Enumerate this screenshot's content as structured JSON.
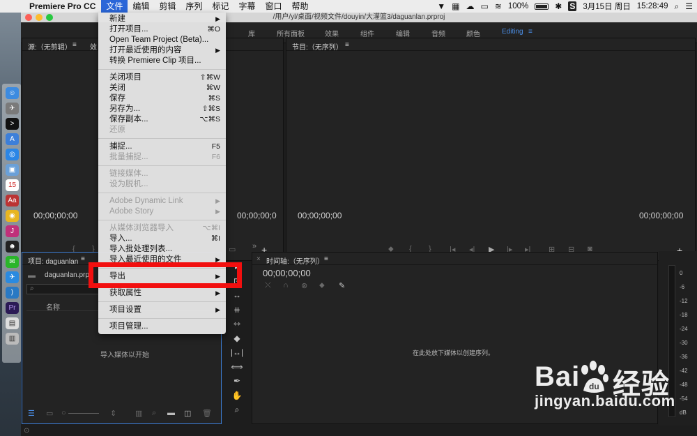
{
  "menubar": {
    "app": "Premiere Pro CC",
    "items": [
      "文件",
      "编辑",
      "剪辑",
      "序列",
      "标记",
      "字幕",
      "窗口",
      "帮助"
    ],
    "battery": "100%",
    "date": "3月15日 周日",
    "time": "15:28:49"
  },
  "window": {
    "title": "/用户/yl/桌面/视频文件/douyin/大灌篮3/daguanlan.prproj",
    "workspaces": [
      "库",
      "所有面板",
      "效果",
      "组件",
      "编辑",
      "音频",
      "颜色",
      "Editing"
    ]
  },
  "source_panel": {
    "title": "源:（无剪辑）",
    "tab2": "效",
    "tc_left": "00;00;00;00",
    "tc_right": "00;00;00;0"
  },
  "program_panel": {
    "title": "节目:（无序列）",
    "tc_left": "00;00;00;00",
    "tc_right": "00;00;00;00"
  },
  "project_panel": {
    "title": "项目: daguanlan",
    "file": "daguanlan.prpr",
    "column_name": "名称",
    "empty_hint": "导入媒体以开始"
  },
  "timeline_panel": {
    "title": "时间轴:（无序列）",
    "tc": "00;00;00;00",
    "empty_hint": "在此处放下媒体以创建序列。"
  },
  "meter": {
    "labels": [
      "0",
      "-6",
      "-12",
      "-18",
      "-24",
      "-30",
      "-36",
      "-42",
      "-48",
      "-54",
      "dB"
    ]
  },
  "file_menu": {
    "items": [
      {
        "label": "新建",
        "arrow": true
      },
      {
        "label": "打开项目...",
        "shortcut": "⌘O"
      },
      {
        "label": "Open Team Project (Beta)..."
      },
      {
        "label": "打开最近使用的内容",
        "arrow": true
      },
      {
        "label": "转换 Premiere Clip 项目..."
      },
      {
        "label": "关闭项目",
        "shortcut": "⇧⌘W"
      },
      {
        "label": "关闭",
        "shortcut": "⌘W"
      },
      {
        "label": "保存",
        "shortcut": "⌘S"
      },
      {
        "label": "另存为...",
        "shortcut": "⇧⌘S"
      },
      {
        "label": "保存副本...",
        "shortcut": "⌥⌘S"
      },
      {
        "label": "还原",
        "disabled": true
      },
      {
        "label": "捕捉...",
        "shortcut": "F5"
      },
      {
        "label": "批量捕捉...",
        "shortcut": "F6",
        "disabled": true
      },
      {
        "label": "链接媒体...",
        "disabled": true
      },
      {
        "label": "设为脱机...",
        "disabled": true
      },
      {
        "label": "Adobe Dynamic Link",
        "arrow": true,
        "disabled": true
      },
      {
        "label": "Adobe Story",
        "arrow": true,
        "disabled": true
      },
      {
        "label": "从媒体浏览器导入",
        "shortcut": "⌥⌘I",
        "disabled": true
      },
      {
        "label": "导入...",
        "shortcut": "⌘I"
      },
      {
        "label": "导入批处理列表..."
      },
      {
        "label": "导入最近使用的文件",
        "arrow": true
      },
      {
        "label": "导出",
        "arrow": true
      },
      {
        "label": "获取属性",
        "arrow": true
      },
      {
        "label": "项目设置",
        "arrow": true
      },
      {
        "label": "项目管理..."
      }
    ]
  },
  "watermark": {
    "brand": "Bai",
    "brand_cn": "经验",
    "url": "jingyan.baidu.com"
  }
}
